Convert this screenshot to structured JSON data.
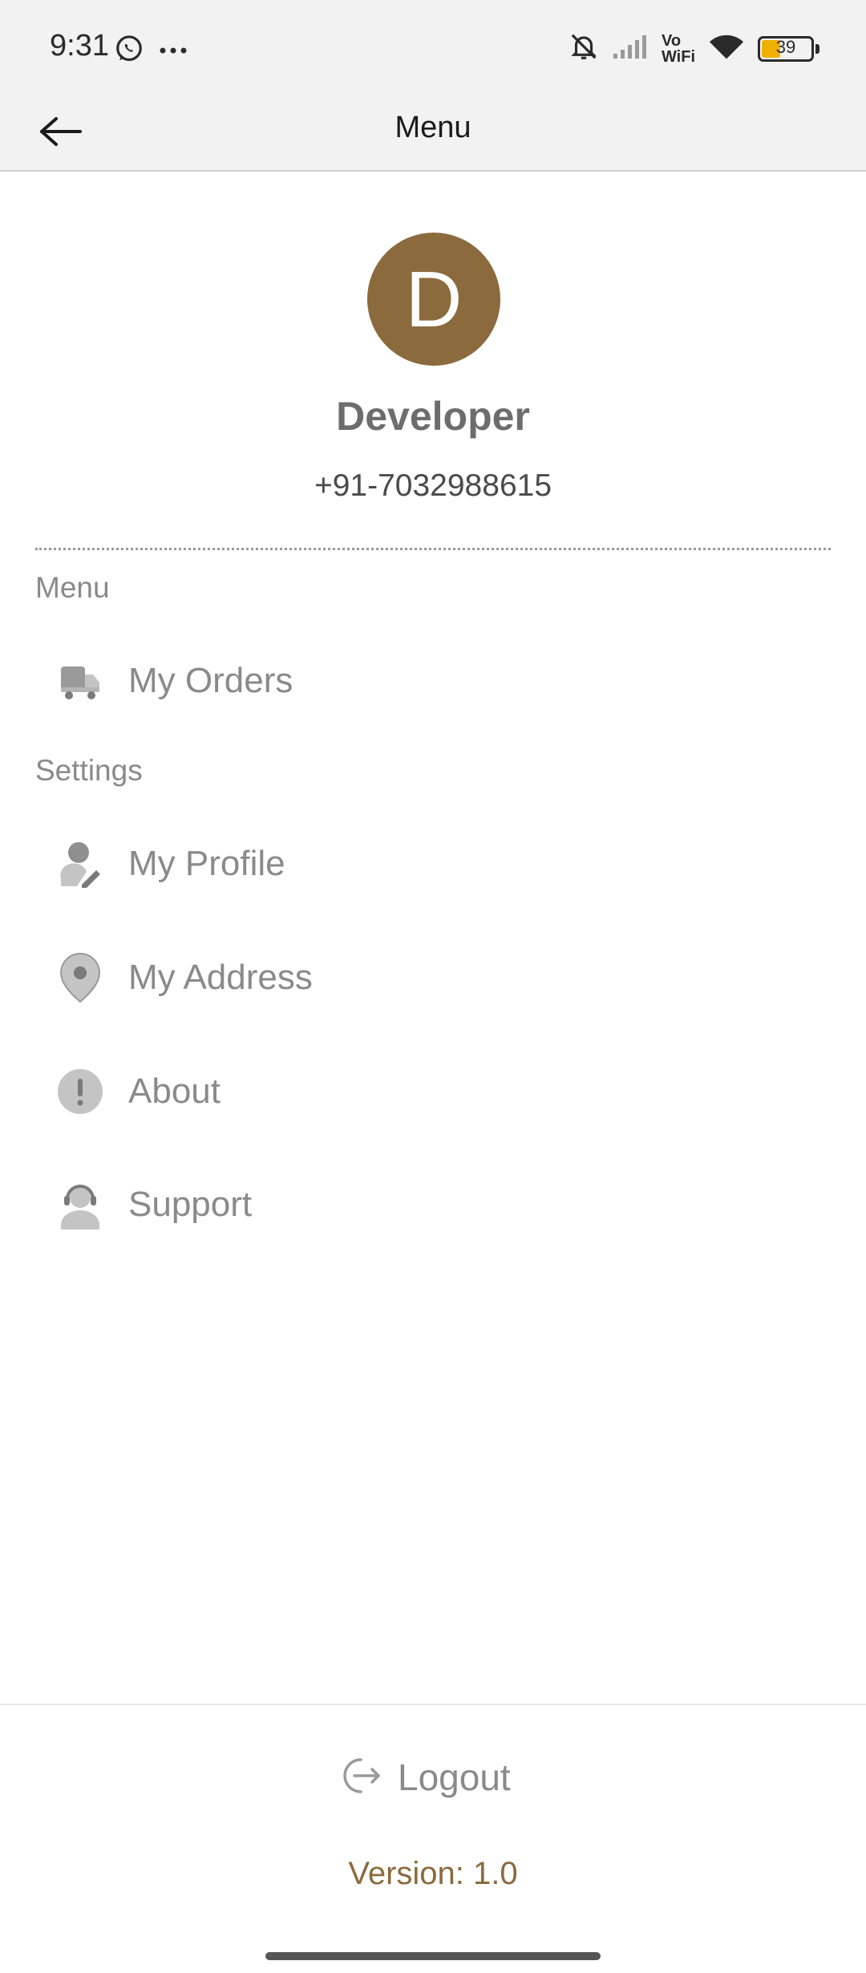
{
  "status_bar": {
    "time": "9:31",
    "battery_level": "39",
    "battery_fraction": 0.39,
    "network_label_top": "Vo",
    "network_label_bottom": "WiFi"
  },
  "header": {
    "title": "Menu"
  },
  "profile": {
    "initial": "D",
    "name": "Developer",
    "phone": "+91-7032988615",
    "avatar_color": "#8b6a3d"
  },
  "sections": {
    "menu_label": "Menu",
    "settings_label": "Settings"
  },
  "menu_items": [
    {
      "label": "My Orders",
      "icon": "delivery-truck-icon"
    }
  ],
  "settings_items": [
    {
      "label": "My Profile",
      "icon": "user-edit-icon"
    },
    {
      "label": "My Address",
      "icon": "location-pin-icon"
    },
    {
      "label": "About",
      "icon": "info-exclamation-icon"
    },
    {
      "label": "Support",
      "icon": "support-headset-icon"
    }
  ],
  "footer": {
    "logout_label": "Logout",
    "version": "Version: 1.0",
    "accent_color": "#8b6a3d"
  }
}
